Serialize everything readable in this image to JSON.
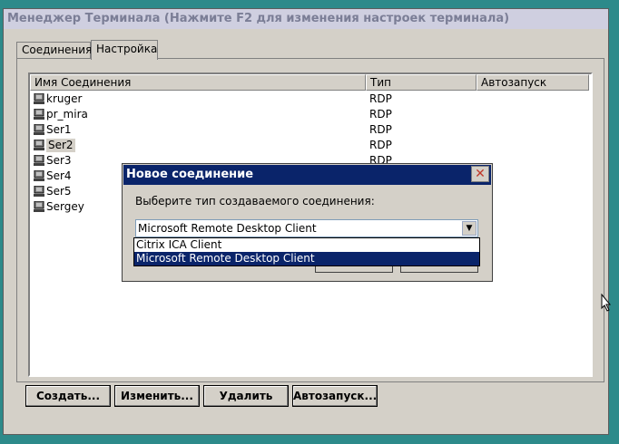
{
  "window": {
    "title": "Менеджер Терминала (Нажмите F2 для изменения настроек терминала)"
  },
  "tabs": [
    {
      "label": "Соединения"
    },
    {
      "label": "Настройка"
    }
  ],
  "list": {
    "columns": [
      "Имя Соединения",
      "Тип",
      "Автозапуск"
    ],
    "rows": [
      {
        "name": "kruger",
        "type": "RDP"
      },
      {
        "name": "pr_mira",
        "type": "RDP"
      },
      {
        "name": "Ser1",
        "type": "RDP"
      },
      {
        "name": "Ser2",
        "type": "RDP"
      },
      {
        "name": "Ser3",
        "type": "RDP"
      },
      {
        "name": "Ser4",
        "type": ""
      },
      {
        "name": "Ser5",
        "type": ""
      },
      {
        "name": "Sergey",
        "type": ""
      }
    ]
  },
  "buttons": {
    "create": "Создать...",
    "edit": "Изменить...",
    "delete": "Удалить",
    "autostart": "Автозапуск..."
  },
  "dialog": {
    "title": "Новое соединение",
    "close": "✕",
    "label": "Выберите тип создаваемого соединения:",
    "selected": "Microsoft Remote Desktop Client",
    "options": [
      "Citrix ICA Client",
      "Microsoft Remote Desktop Client"
    ]
  },
  "colors": {
    "desktop": "#2d8a8a",
    "selection": "#0a246a"
  }
}
